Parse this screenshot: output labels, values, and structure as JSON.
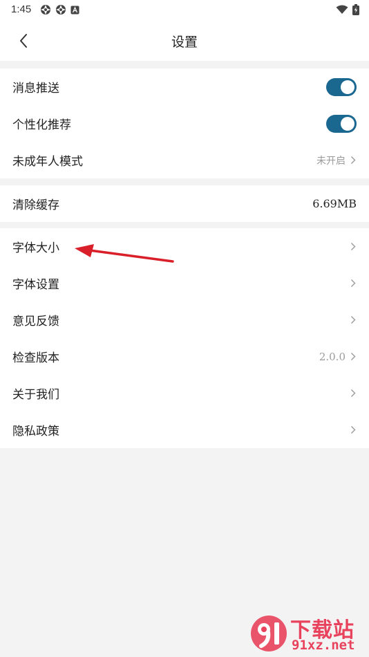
{
  "status_bar": {
    "time": "1:45"
  },
  "header": {
    "title": "设置"
  },
  "group1": {
    "items": [
      {
        "label": "消息推送",
        "toggle": true
      },
      {
        "label": "个性化推荐",
        "toggle": true
      },
      {
        "label": "未成年人模式",
        "value": "未开启"
      }
    ]
  },
  "group2": {
    "items": [
      {
        "label": "清除缓存",
        "value": "6.69MB"
      }
    ]
  },
  "group3": {
    "items": [
      {
        "label": "字体大小"
      },
      {
        "label": "字体设置"
      },
      {
        "label": "意见反馈"
      },
      {
        "label": "检查版本",
        "value": "2.0.0"
      },
      {
        "label": "关于我们"
      },
      {
        "label": "隐私政策"
      }
    ]
  },
  "colors": {
    "toggle_on": "#1a6790",
    "annotation_arrow": "#d9202a",
    "watermark": "#e8425c"
  },
  "watermark": {
    "top_text": "下载站",
    "bottom_text": "91xz.net"
  }
}
